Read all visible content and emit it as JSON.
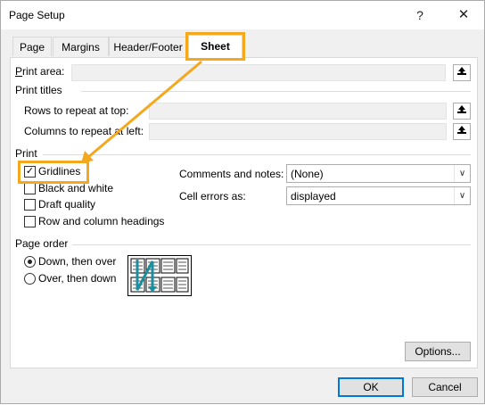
{
  "window": {
    "title": "Page Setup",
    "help_label": "?",
    "close_label": "✕"
  },
  "tabs": [
    "Page",
    "Margins",
    "Header/Footer",
    "Sheet"
  ],
  "print_area": {
    "label": "Print area:",
    "value": ""
  },
  "print_titles": {
    "heading": "Print titles",
    "rows_label": "Rows to repeat at top:",
    "rows_value": "",
    "cols_label": "Columns to repeat at left:",
    "cols_value": ""
  },
  "print": {
    "heading": "Print",
    "gridlines": {
      "label": "Gridlines",
      "checked": true
    },
    "black_white": {
      "label": "Black and white",
      "checked": false
    },
    "draft": {
      "label": "Draft quality",
      "checked": false
    },
    "headings": {
      "label": "Row and column headings",
      "checked": false
    },
    "comments_label": "Comments and notes:",
    "comments_value": "(None)",
    "errors_label": "Cell errors as:",
    "errors_value": "displayed"
  },
  "page_order": {
    "heading": "Page order",
    "down_label": "Down, then over",
    "over_label": "Over, then down",
    "selected": "down"
  },
  "buttons": {
    "options": "Options...",
    "ok": "OK",
    "cancel": "Cancel"
  },
  "colors": {
    "highlight": "#f4a81d",
    "ok_border": "#0078d7",
    "preview_arrow": "#1a8fa0"
  },
  "icons": {
    "collapse": "collapse-dialog-icon",
    "dropdown": "chevron-down-icon"
  }
}
